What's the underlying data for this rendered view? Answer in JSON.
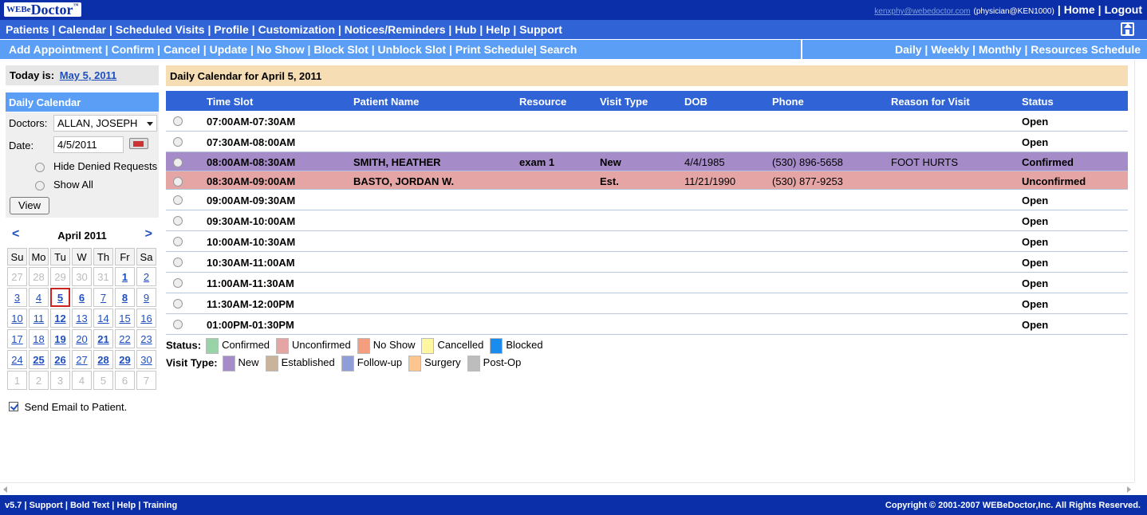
{
  "app": {
    "logo_prefix": "WEBe",
    "logo_main": "Doctor",
    "logo_tm": "™",
    "user_email": "kenxphy@webedoctor.com",
    "user_role": "(physician@KEN1000)",
    "home_link": "Home",
    "logout_link": "Logout"
  },
  "nav1": [
    "Patients",
    "Calendar",
    "Scheduled Visits",
    "Profile",
    "Customization",
    "Notices/Reminders",
    "Hub",
    "Help",
    "Support"
  ],
  "nav2_left": [
    "Add Appointment",
    "Confirm",
    "Cancel",
    "Update",
    "No Show",
    "Block Slot",
    "Unblock Slot",
    "Print Schedule",
    "Search"
  ],
  "nav2_right": [
    "Daily",
    "Weekly",
    "Monthly",
    "Resources Schedule"
  ],
  "sidebar": {
    "today_label": "Today is:",
    "today_date": "May 5, 2011",
    "panel_title": "Daily Calendar",
    "doctors_label": "Doctors:",
    "doctor_value": "ALLAN, JOSEPH",
    "date_label": "Date:",
    "date_value": "4/5/2011",
    "hide_denied": "Hide Denied Requests",
    "show_all": "Show All",
    "view_button": "View",
    "send_email": "Send Email to Patient."
  },
  "mini_calendar": {
    "prev": "<",
    "next": ">",
    "month": "April 2011",
    "weekdays": [
      "Su",
      "Mo",
      "Tu",
      "W",
      "Th",
      "Fr",
      "Sa"
    ],
    "weeks": [
      [
        {
          "d": "27",
          "k": "o"
        },
        {
          "d": "28",
          "k": "o"
        },
        {
          "d": "29",
          "k": "o"
        },
        {
          "d": "30",
          "k": "o"
        },
        {
          "d": "31",
          "k": "o"
        },
        {
          "d": "1",
          "k": "b"
        },
        {
          "d": "2",
          "k": "n"
        }
      ],
      [
        {
          "d": "3",
          "k": "n"
        },
        {
          "d": "4",
          "k": "n"
        },
        {
          "d": "5",
          "k": "t"
        },
        {
          "d": "6",
          "k": "b"
        },
        {
          "d": "7",
          "k": "n"
        },
        {
          "d": "8",
          "k": "b"
        },
        {
          "d": "9",
          "k": "n"
        }
      ],
      [
        {
          "d": "10",
          "k": "n"
        },
        {
          "d": "11",
          "k": "n"
        },
        {
          "d": "12",
          "k": "b"
        },
        {
          "d": "13",
          "k": "n"
        },
        {
          "d": "14",
          "k": "n"
        },
        {
          "d": "15",
          "k": "n"
        },
        {
          "d": "16",
          "k": "n"
        }
      ],
      [
        {
          "d": "17",
          "k": "n"
        },
        {
          "d": "18",
          "k": "n"
        },
        {
          "d": "19",
          "k": "b"
        },
        {
          "d": "20",
          "k": "n"
        },
        {
          "d": "21",
          "k": "b"
        },
        {
          "d": "22",
          "k": "n"
        },
        {
          "d": "23",
          "k": "n"
        }
      ],
      [
        {
          "d": "24",
          "k": "n"
        },
        {
          "d": "25",
          "k": "b"
        },
        {
          "d": "26",
          "k": "b"
        },
        {
          "d": "27",
          "k": "n"
        },
        {
          "d": "28",
          "k": "b"
        },
        {
          "d": "29",
          "k": "b"
        },
        {
          "d": "30",
          "k": "n"
        }
      ],
      [
        {
          "d": "1",
          "k": "o"
        },
        {
          "d": "2",
          "k": "o"
        },
        {
          "d": "3",
          "k": "o"
        },
        {
          "d": "4",
          "k": "o"
        },
        {
          "d": "5",
          "k": "o"
        },
        {
          "d": "6",
          "k": "o"
        },
        {
          "d": "7",
          "k": "o"
        }
      ]
    ]
  },
  "main": {
    "title": "Daily Calendar for April 5, 2011",
    "columns": [
      "Time Slot",
      "Patient Name",
      "Resource",
      "Visit Type",
      "DOB",
      "Phone",
      "Reason for Visit",
      "Status"
    ],
    "rows": [
      {
        "time": "07:00AM-07:30AM",
        "patient": "",
        "resource": "",
        "visit": "",
        "dob": "",
        "phone": "",
        "reason": "",
        "status": "Open",
        "cls": ""
      },
      {
        "time": "07:30AM-08:00AM",
        "patient": "",
        "resource": "",
        "visit": "",
        "dob": "",
        "phone": "",
        "reason": "",
        "status": "Open",
        "cls": ""
      },
      {
        "time": "08:00AM-08:30AM",
        "patient": "SMITH, HEATHER",
        "resource": "exam 1",
        "visit": "New",
        "dob": "4/4/1985",
        "phone": "(530) 896-5658",
        "reason": "FOOT HURTS",
        "status": "Confirmed",
        "cls": "new"
      },
      {
        "time": "08:30AM-09:00AM",
        "patient": "BASTO, JORDAN W.",
        "resource": "",
        "visit": "Est.",
        "dob": "11/21/1990",
        "phone": "(530) 877-9253",
        "reason": "",
        "status": "Unconfirmed",
        "cls": "unc"
      },
      {
        "time": "09:00AM-09:30AM",
        "patient": "",
        "resource": "",
        "visit": "",
        "dob": "",
        "phone": "",
        "reason": "",
        "status": "Open",
        "cls": ""
      },
      {
        "time": "09:30AM-10:00AM",
        "patient": "",
        "resource": "",
        "visit": "",
        "dob": "",
        "phone": "",
        "reason": "",
        "status": "Open",
        "cls": ""
      },
      {
        "time": "10:00AM-10:30AM",
        "patient": "",
        "resource": "",
        "visit": "",
        "dob": "",
        "phone": "",
        "reason": "",
        "status": "Open",
        "cls": ""
      },
      {
        "time": "10:30AM-11:00AM",
        "patient": "",
        "resource": "",
        "visit": "",
        "dob": "",
        "phone": "",
        "reason": "",
        "status": "Open",
        "cls": ""
      },
      {
        "time": "11:00AM-11:30AM",
        "patient": "",
        "resource": "",
        "visit": "",
        "dob": "",
        "phone": "",
        "reason": "",
        "status": "Open",
        "cls": ""
      },
      {
        "time": "11:30AM-12:00PM",
        "patient": "",
        "resource": "",
        "visit": "",
        "dob": "",
        "phone": "",
        "reason": "",
        "status": "Open",
        "cls": ""
      },
      {
        "time": "01:00PM-01:30PM",
        "patient": "",
        "resource": "",
        "visit": "",
        "dob": "",
        "phone": "",
        "reason": "",
        "status": "Open",
        "cls": ""
      }
    ]
  },
  "legend": {
    "status_label": "Status:",
    "status_items": [
      {
        "label": "Confirmed",
        "color": "#99d3a8"
      },
      {
        "label": "Unconfirmed",
        "color": "#e6a5a5"
      },
      {
        "label": "No Show",
        "color": "#f59d7f"
      },
      {
        "label": "Cancelled",
        "color": "#fff6a0"
      },
      {
        "label": "Blocked",
        "color": "#1a8cf0"
      }
    ],
    "visit_label": "Visit Type:",
    "visit_items": [
      {
        "label": "New",
        "color": "#a68bc9"
      },
      {
        "label": "Established",
        "color": "#c9b39a"
      },
      {
        "label": "Follow-up",
        "color": "#8f9ed8"
      },
      {
        "label": "Surgery",
        "color": "#fcc68e"
      },
      {
        "label": "Post-Op",
        "color": "#bdbdbd"
      }
    ]
  },
  "footer": {
    "left": "v5.7 | Support | Bold Text | Help | Training",
    "right": "Copyright © 2001-2007 WEBeDoctor,Inc. All Rights Reserved."
  }
}
